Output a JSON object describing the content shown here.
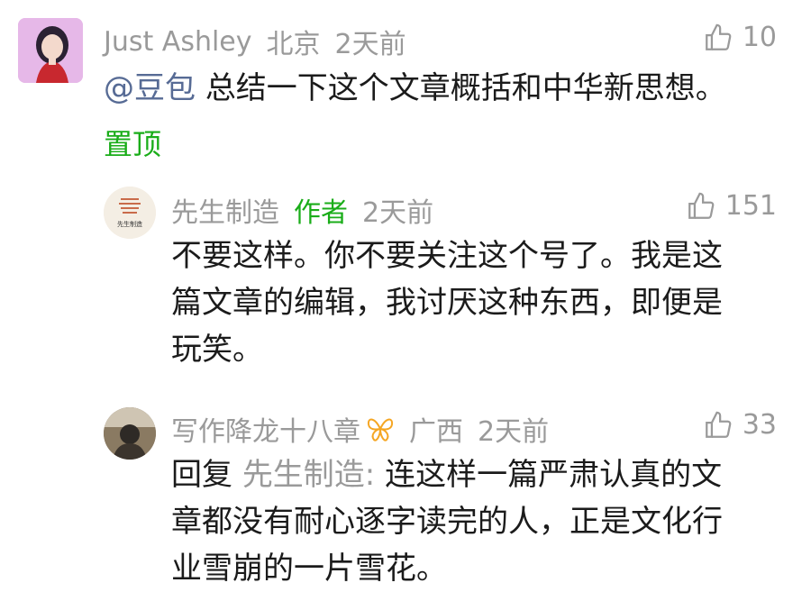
{
  "comments": [
    {
      "author": "Just Ashley",
      "location": "北京",
      "time": "2天前",
      "likes": "10",
      "mention": "@豆包",
      "text": "总结一下这个文章概括和中华新思想。",
      "pinned_label": "置顶",
      "avatar_icon": "avatar-woman-icon"
    }
  ],
  "replies": [
    {
      "author": "先生制造",
      "author_tag": "作者",
      "time": "2天前",
      "likes": "151",
      "text_lines": [
        "不要这样。你不要关注这个号了。我是这",
        "篇文章的编辑，我讨厌这种东西，即便是",
        "玩笑。"
      ],
      "avatar_icon": "brand-logo-icon",
      "avatar_caption": "先生制造"
    },
    {
      "author": "写作降龙十八章",
      "location": "广西",
      "time": "2天前",
      "likes": "33",
      "reply_label": "回复",
      "reply_target": "先生制造:",
      "text_lines": [
        "连这样一篇严肃认真的文",
        "章都没有耐心逐字读完的人，正是文化行",
        "业雪崩的一片雪花。"
      ],
      "badge_icon": "butterfly-badge-icon",
      "avatar_icon": "avatar-photo-icon"
    }
  ],
  "colors": {
    "meta_gray": "#9a9a9a",
    "author_green": "#1aad19",
    "mention_blue": "#576b95",
    "text": "#1b1b1b",
    "badge_orange": "#f5a623"
  }
}
